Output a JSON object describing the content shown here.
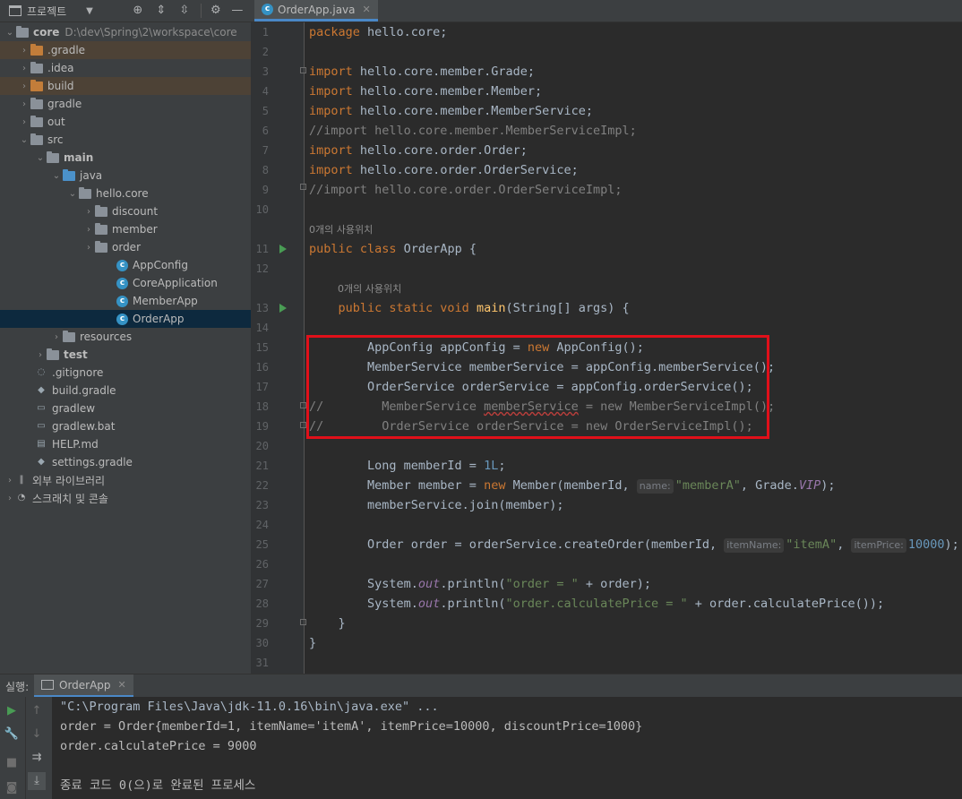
{
  "project_panel": {
    "title": "프로젝트",
    "tree": [
      {
        "label": "core",
        "path": "D:\\dev\\Spring\\2\\workspace\\core"
      },
      {
        "label": ".gradle"
      },
      {
        "label": ".idea"
      },
      {
        "label": "build"
      },
      {
        "label": "gradle"
      },
      {
        "label": "out"
      },
      {
        "label": "src"
      },
      {
        "label": "main"
      },
      {
        "label": "java"
      },
      {
        "label": "hello.core"
      },
      {
        "label": "discount"
      },
      {
        "label": "member"
      },
      {
        "label": "order"
      },
      {
        "label": "AppConfig"
      },
      {
        "label": "CoreApplication"
      },
      {
        "label": "MemberApp"
      },
      {
        "label": "OrderApp"
      },
      {
        "label": "resources"
      },
      {
        "label": "test"
      },
      {
        "label": ".gitignore"
      },
      {
        "label": "build.gradle"
      },
      {
        "label": "gradlew"
      },
      {
        "label": "gradlew.bat"
      },
      {
        "label": "HELP.md"
      },
      {
        "label": "settings.gradle"
      },
      {
        "label": "외부 라이브러리"
      },
      {
        "label": "스크래치 및 콘솔"
      }
    ]
  },
  "editor": {
    "tab_label": "OrderApp.java",
    "line_numbers": [
      "1",
      "2",
      "3",
      "4",
      "5",
      "6",
      "7",
      "8",
      "9",
      "10",
      "11",
      "12",
      "13",
      "14",
      "15",
      "16",
      "17",
      "18",
      "19",
      "20",
      "21",
      "22",
      "23",
      "24",
      "25",
      "26",
      "27",
      "28",
      "29",
      "30",
      "31"
    ],
    "usage_hint_class": "0개의 사용위치",
    "usage_hint_method": "0개의 사용위치",
    "code": {
      "l1_kw": "package",
      "l1_rest": " hello.core;",
      "l3_kw": "import",
      "l3_rest": " hello.core.member.Grade;",
      "l4_kw": "import",
      "l4_rest": " hello.core.member.Member;",
      "l5_kw": "import",
      "l5_rest": " hello.core.member.MemberService;",
      "l6": "//import hello.core.member.MemberServiceImpl;",
      "l7_kw": "import",
      "l7_rest": " hello.core.order.Order;",
      "l8_kw": "import",
      "l8_rest": " hello.core.order.OrderService;",
      "l9": "//import hello.core.order.OrderServiceImpl;",
      "l11_kw": "public class",
      "l11_rest": " OrderApp {",
      "l13_indent": "    ",
      "l13_kw": "public static void",
      "l13_fn": " main",
      "l13_rest": "(String[] args) {",
      "l15_a": "        AppConfig appConfig = ",
      "l15_kw": "new",
      "l15_b": " AppConfig();",
      "l16": "        MemberService memberService = appConfig.memberService();",
      "l17": "        OrderService orderService = appConfig.orderService();",
      "l18_cm": "//",
      "l18_a": "        MemberService ",
      "l18_sq": "memberService",
      "l18_b": " = new MemberServiceImpl();",
      "l19_cm": "//",
      "l19_a": "        OrderService orderService = new OrderServiceImpl();",
      "l21_a": "        Long memberId = ",
      "l21_num": "1L",
      "l21_b": ";",
      "l22_a": "        Member member = ",
      "l22_kw": "new",
      "l22_b": " Member(memberId, ",
      "l22_hint": "name:",
      "l22_str": "\"memberA\"",
      "l22_c": ", Grade.",
      "l22_it": "VIP",
      "l22_d": ");",
      "l23": "        memberService.join(member);",
      "l25_a": "        Order order = orderService.createOrder(memberId, ",
      "l25_hint1": "itemName:",
      "l25_str": "\"itemA\"",
      "l25_b": ", ",
      "l25_hint2": "itemPrice:",
      "l25_num": "10000",
      "l25_c": ");",
      "l27_a": "        System.",
      "l27_it": "out",
      "l27_b": ".println(",
      "l27_str": "\"order = \"",
      "l27_c": " + order);",
      "l28_a": "        System.",
      "l28_it": "out",
      "l28_b": ".println(",
      "l28_str": "\"order.calculatePrice = \"",
      "l28_c": " + order.calculatePrice());",
      "l29": "    }",
      "l30": "}"
    }
  },
  "run_panel": {
    "label": "실행:",
    "tab_label": "OrderApp",
    "console_lines": [
      "\"C:\\Program Files\\Java\\jdk-11.0.16\\bin\\java.exe\" ...",
      "order = Order{memberId=1, itemName='itemA', itemPrice=10000, discountPrice=1000}",
      "order.calculatePrice = 9000",
      "",
      "종료 코드 0(으)로 완료된 프로세스"
    ]
  },
  "colors": {
    "keyword": "#cc7832",
    "comment": "#808080",
    "string": "#6a8759",
    "number": "#6897bb",
    "method": "#ffc66d",
    "highlight_box": "#e0101a"
  }
}
